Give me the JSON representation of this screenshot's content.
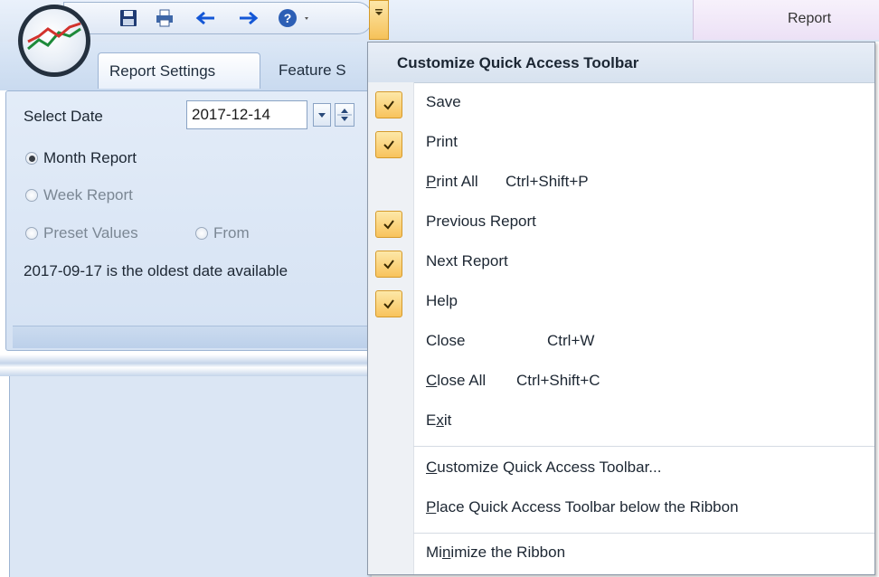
{
  "title_bar": {
    "contextual_tab": "Report"
  },
  "quick_access": {
    "buttons": [
      {
        "name": "save-icon"
      },
      {
        "name": "print-icon"
      },
      {
        "name": "previous-report-icon"
      },
      {
        "name": "next-report-icon"
      },
      {
        "name": "help-icon"
      }
    ],
    "dropdown_icon": "customize-dropdown-icon"
  },
  "ribbon": {
    "tabs": [
      {
        "label": "Report Settings",
        "selected": true
      },
      {
        "label": "Feature S",
        "selected": false
      }
    ],
    "panel": {
      "select_date_label": "Select Date",
      "date_value": "2017-12-14",
      "radios": [
        {
          "label": "Month Report",
          "checked": true,
          "enabled": true
        },
        {
          "label": "Week Report",
          "checked": false,
          "enabled": false
        },
        {
          "label": "Preset Values",
          "checked": false,
          "enabled": false
        },
        {
          "label": "From",
          "checked": false,
          "enabled": false
        }
      ],
      "info_text": "2017-09-17 is the oldest date available"
    }
  },
  "menu": {
    "header": "Customize Quick Access Toolbar",
    "items": [
      {
        "label": "Save",
        "checked": true,
        "shortcut": ""
      },
      {
        "label": "Print",
        "checked": true,
        "shortcut": ""
      },
      {
        "label": "Print All",
        "checked": false,
        "shortcut": "Ctrl+Shift+P",
        "underline": "P"
      },
      {
        "label": "Previous Report",
        "checked": true,
        "shortcut": ""
      },
      {
        "label": "Next Report",
        "checked": true,
        "shortcut": ""
      },
      {
        "label": "Help",
        "checked": true,
        "shortcut": ""
      },
      {
        "label": "Close",
        "checked": false,
        "shortcut": "Ctrl+W"
      },
      {
        "label": "Close All",
        "checked": false,
        "shortcut": "Ctrl+Shift+C",
        "underline": "C"
      },
      {
        "label": "Exit",
        "checked": false,
        "shortcut": "",
        "underline": "x"
      }
    ],
    "customize_label": "Customize Quick Access Toolbar...",
    "place_below_label": "Place Quick Access Toolbar below the Ribbon",
    "minimize_label": "Minimize the Ribbon"
  },
  "colors": {
    "check_fill": "#f8c35c",
    "ribbon_blue": "#d5e2f3",
    "menu_header": "#d7e2ef"
  }
}
